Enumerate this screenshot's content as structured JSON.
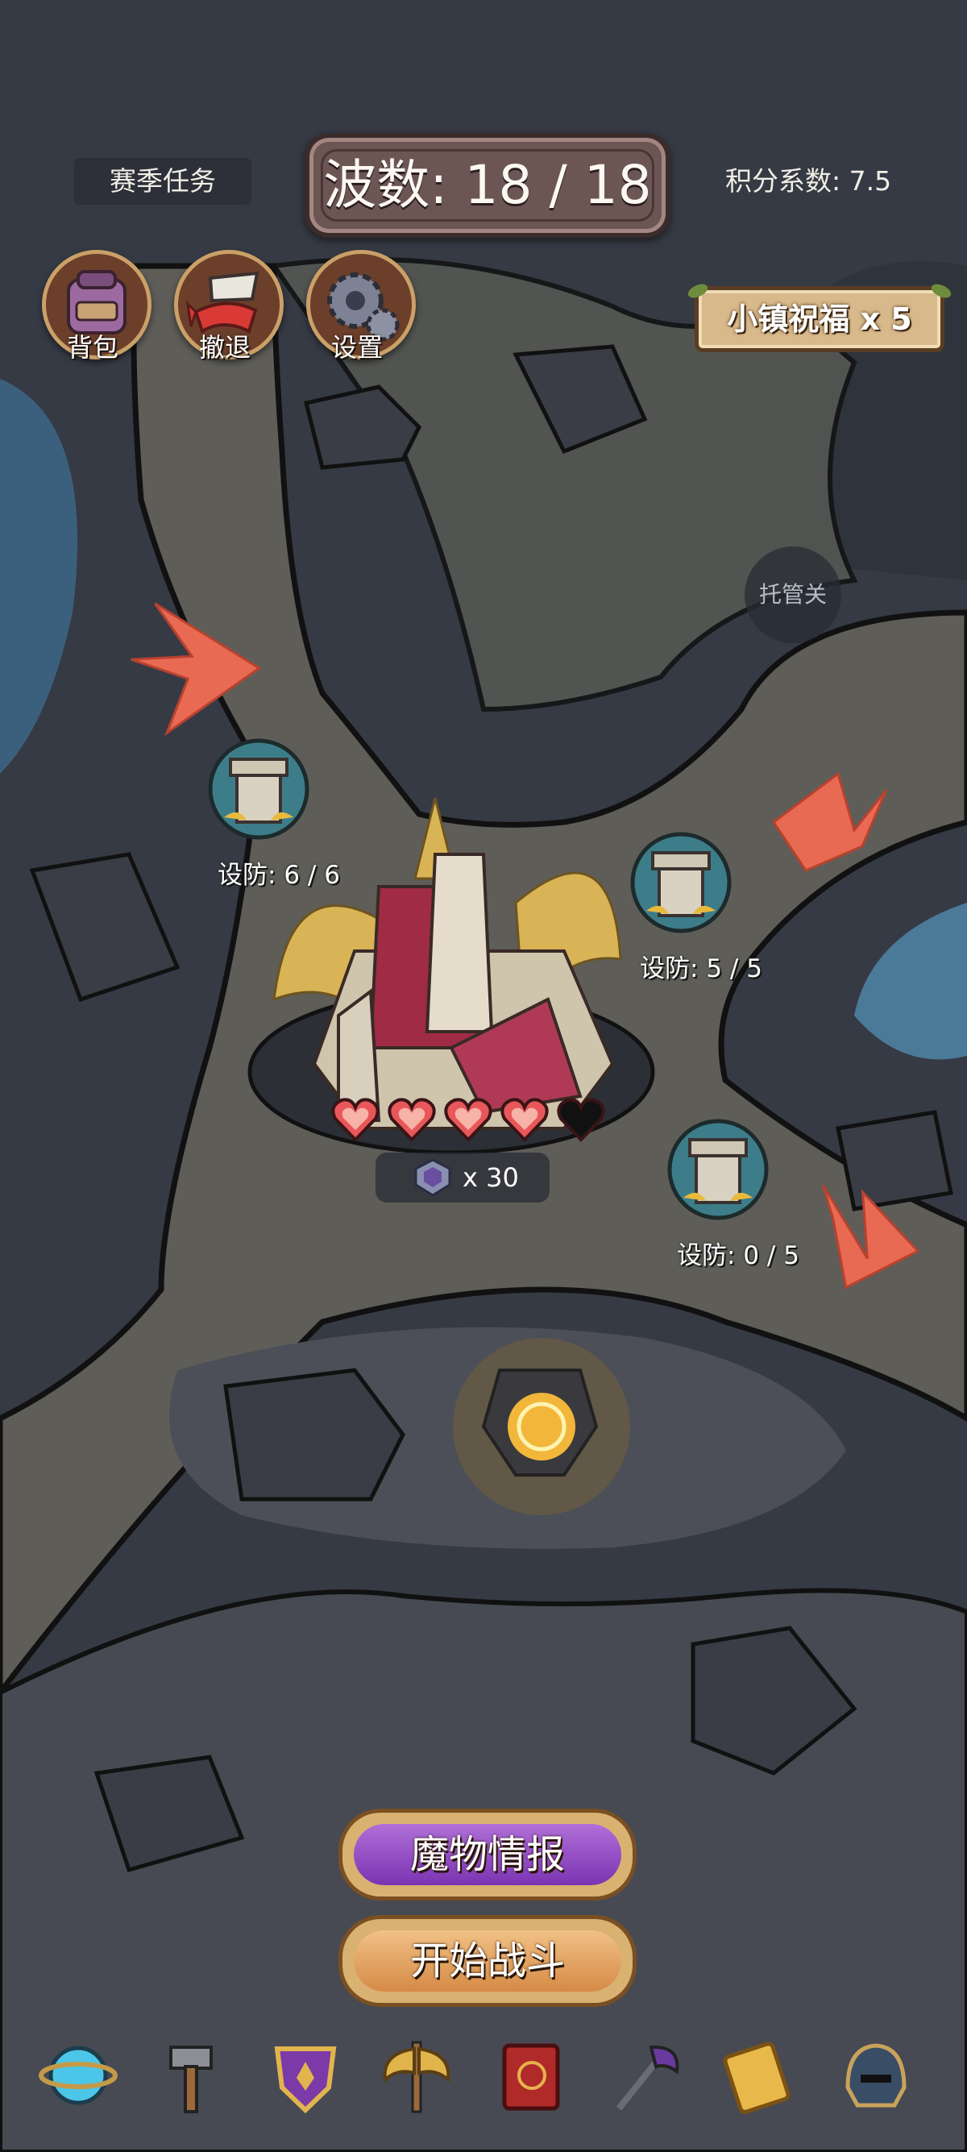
{
  "header": {
    "season_tasks": "赛季任务",
    "wave": "波数: 18 / 18",
    "score_coefficient": "积分系数: 7.5"
  },
  "town_blessing": "小镇祝福 x 5",
  "toolbar": {
    "bag": "背包",
    "retreat": "撤退",
    "settings": "设置"
  },
  "auto_button": "托管关",
  "towers": [
    {
      "label": "设防: 6 / 6",
      "built": 6,
      "max": 6
    },
    {
      "label": "设防: 5 / 5",
      "built": 5,
      "max": 5
    },
    {
      "label": "设防: 0 / 5",
      "built": 0,
      "max": 5
    }
  ],
  "base": {
    "hearts_total": 5,
    "hearts_full": 4,
    "medal_count": "x 30"
  },
  "buttons": {
    "monster_info": "魔物情报",
    "start_battle": "开始战斗"
  },
  "dock_icons": [
    "orb-icon",
    "hammer-icon",
    "shield-crest-icon",
    "axe-icon",
    "red-book-icon",
    "halberd-icon",
    "ticket-icon",
    "helmet-icon"
  ],
  "colors": {
    "arrow": "#e86a52",
    "heart_full": "#e8575a",
    "heart_empty": "#111111",
    "monster_button": "#9b4fcf",
    "battle_button": "#e2a05c"
  }
}
